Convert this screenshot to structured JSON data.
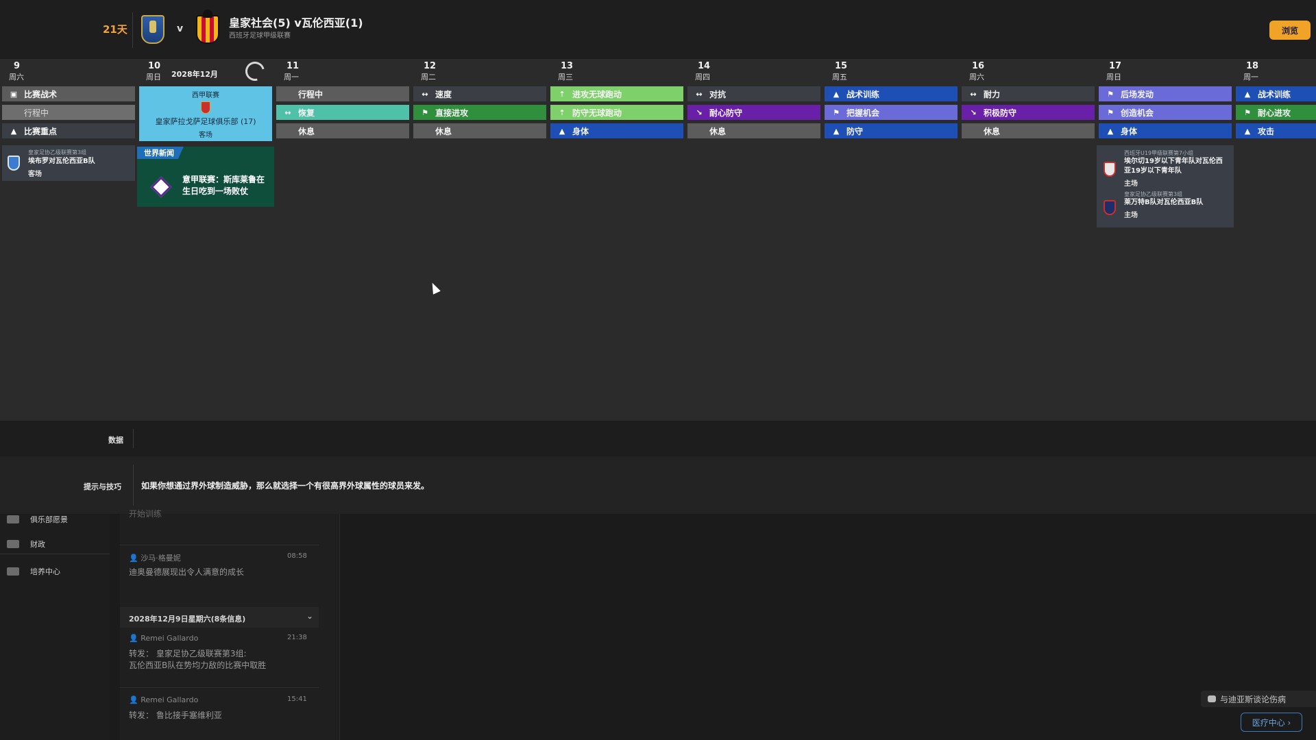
{
  "header": {
    "days_remaining": "21天",
    "vs": "v",
    "match_title": "皇家社会(5) v瓦伦西亚(1)",
    "competition": "西班牙足球甲级联赛",
    "browse_label": "浏览"
  },
  "calendar": {
    "month_label": "2028年12月",
    "days": [
      {
        "num": "9",
        "name": "周六"
      },
      {
        "num": "10",
        "name": "周日"
      },
      {
        "num": "11",
        "name": "周一"
      },
      {
        "num": "12",
        "name": "周二"
      },
      {
        "num": "13",
        "name": "周三"
      },
      {
        "num": "14",
        "name": "周四"
      },
      {
        "num": "15",
        "name": "周五"
      },
      {
        "num": "16",
        "name": "周六"
      },
      {
        "num": "17",
        "name": "周日"
      },
      {
        "num": "18",
        "name": "周一"
      }
    ],
    "sessions": {
      "d9": [
        "比赛战术",
        "行程中",
        "比赛重点"
      ],
      "d11": [
        "行程中",
        "恢复",
        "休息"
      ],
      "d12": [
        "速度",
        "直接进攻",
        "休息"
      ],
      "d13": [
        "进攻无球跑动",
        "防守无球跑动",
        "身体"
      ],
      "d14": [
        "对抗",
        "耐心防守",
        "休息"
      ],
      "d15": [
        "战术训练",
        "把握机会",
        "防守"
      ],
      "d16": [
        "耐力",
        "积极防守",
        "休息"
      ],
      "d17": [
        "后场发动",
        "创造机会",
        "身体"
      ],
      "d18": [
        "战术训练",
        "耐心进攻",
        "攻击"
      ]
    },
    "colors": {
      "grey": "#5c5c5c",
      "teal": "#4fc1a9",
      "green": "#2f8f3c",
      "light_green": "#7ed06a",
      "purple": "#6a1fa8",
      "blue": "#1e4fb5",
      "lavender": "#6a6ad8",
      "dark": "#3b3f45",
      "match_card": "#5fc3e6"
    },
    "match_card": {
      "competition": "西甲联赛",
      "opponent": "皇家萨拉戈萨足球俱乐部 (17)",
      "venue": "客场"
    },
    "fixture_d9": {
      "competition": "皇家足协乙级联赛第3组",
      "match": "埃布罗对瓦伦西亚B队",
      "venue": "客场"
    },
    "news": {
      "tag": "世界新闻",
      "headline": "意甲联赛：斯库莱鲁在生日吃到一场败仗"
    },
    "fixtures_d17": [
      {
        "competition": "西班牙U19甲级联赛第7小组",
        "match": "埃尔切19岁以下青年队对瓦伦西亚19岁以下青年队",
        "venue": "主场"
      },
      {
        "competition": "皇家足协乙级联赛第3组",
        "match": "莱万特B队对瓦伦西亚B队",
        "venue": "主场"
      }
    ]
  },
  "data_bar": {
    "label": "数据"
  },
  "tips": {
    "label": "提示与技巧",
    "text": "如果你想通过界外球制造威胁，那么就选择一个有很高界外球属性的球员来发。"
  },
  "sidebar": {
    "items": [
      {
        "label": "俱乐部愿景",
        "icon": "vision-icon"
      },
      {
        "label": "财政",
        "icon": "finance-icon"
      },
      {
        "label": "培养中心",
        "icon": "development-icon"
      }
    ]
  },
  "messages": {
    "partial_top": "开始训练",
    "m1": {
      "sender": "沙马·格曼妮",
      "time": "08:58",
      "body": "迪奥曼德展现出令人满意的成长"
    },
    "date_group": "2028年12月9日星期六(8条信息)",
    "m2": {
      "sender": "Remei Gallardo",
      "time": "21:38",
      "body1": "转发：  皇家足协乙级联赛第3组:",
      "body2": "瓦伦西亚B队在势均力敌的比赛中取胜"
    },
    "m3": {
      "sender": "Remei Gallardo",
      "time": "15:41",
      "body": "转发：  鲁比接手塞维利亚"
    }
  },
  "actions": {
    "discuss": "与迪亚斯谈论伤病",
    "medical": "医疗中心 ›"
  }
}
